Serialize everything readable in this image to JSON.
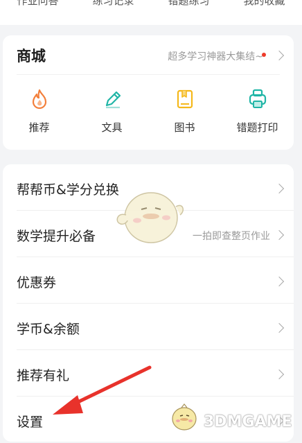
{
  "top_tabs": [
    "作业问答",
    "练习记录",
    "错题练习",
    "我的收藏"
  ],
  "shop": {
    "title": "商城",
    "promo": "超多学习神器大集结~",
    "items": [
      {
        "label": "推荐",
        "icon": "flame-icon"
      },
      {
        "label": "文具",
        "icon": "pen-icon"
      },
      {
        "label": "图书",
        "icon": "book-icon"
      },
      {
        "label": "错题打印",
        "icon": "printer-icon"
      }
    ],
    "accent_orange": "#f37f3b",
    "accent_teal": "#1fb5a6",
    "accent_yellow": "#f5b81a",
    "dot_color": "#ee3b2a"
  },
  "menu": [
    {
      "label": "帮帮币&学分兑换",
      "sub": ""
    },
    {
      "label": "数学提升必备",
      "sub": "一拍即查整页作业"
    },
    {
      "label": "优惠券",
      "sub": ""
    },
    {
      "label": "学币&余额",
      "sub": ""
    },
    {
      "label": "推荐有礼",
      "sub": ""
    },
    {
      "label": "设置",
      "sub": ""
    }
  ],
  "annotation_arrow_color": "#e8322b",
  "watermark": "3DMGAME"
}
